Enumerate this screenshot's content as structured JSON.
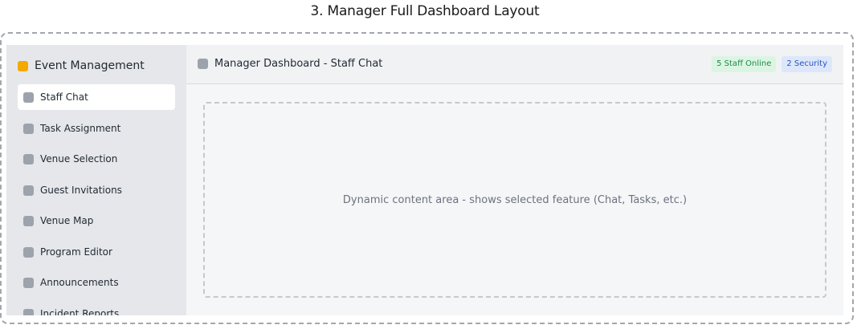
{
  "page": {
    "title": "3. Manager Full Dashboard Layout"
  },
  "sidebar": {
    "brand_label": "Event Management",
    "brand_color": "#f2a900",
    "items": [
      {
        "label": "Staff Chat",
        "active": true
      },
      {
        "label": "Task Assignment",
        "active": false
      },
      {
        "label": "Venue Selection",
        "active": false
      },
      {
        "label": "Guest Invitations",
        "active": false
      },
      {
        "label": "Venue Map",
        "active": false
      },
      {
        "label": "Program Editor",
        "active": false
      },
      {
        "label": "Announcements",
        "active": false
      },
      {
        "label": "Incident Reports",
        "active": false
      }
    ]
  },
  "header": {
    "title": "Manager Dashboard - Staff Chat",
    "badges": {
      "staff_online": "5 Staff Online",
      "security": "2 Security"
    },
    "badge_colors": {
      "staff_online_bg": "#dcf5e3",
      "staff_online_text": "#218a4b",
      "security_bg": "#dce7fb",
      "security_text": "#2a55b8"
    }
  },
  "content": {
    "placeholder": "Dynamic content area - shows selected feature (Chat, Tasks, etc.)"
  }
}
